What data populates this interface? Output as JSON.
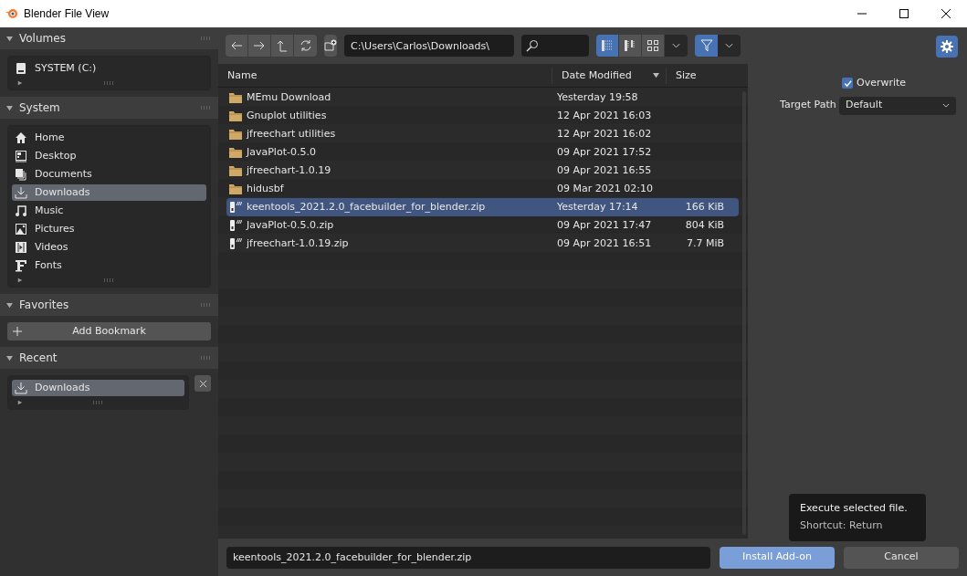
{
  "window": {
    "title": "Blender File View"
  },
  "sidebar": {
    "panels": [
      {
        "title": "Volumes",
        "expanded": true,
        "kind": "list",
        "items": [
          {
            "label": "SYSTEM (C:)",
            "kind": "drive",
            "selected": false
          }
        ]
      },
      {
        "title": "System",
        "expanded": true,
        "kind": "list",
        "items": [
          {
            "label": "Home",
            "kind": "home",
            "selected": false
          },
          {
            "label": "Desktop",
            "kind": "desktop",
            "selected": false
          },
          {
            "label": "Documents",
            "kind": "documents",
            "selected": false
          },
          {
            "label": "Downloads",
            "kind": "download",
            "selected": true
          },
          {
            "label": "Music",
            "kind": "music",
            "selected": false
          },
          {
            "label": "Pictures",
            "kind": "pictures",
            "selected": false
          },
          {
            "label": "Videos",
            "kind": "videos",
            "selected": false
          },
          {
            "label": "Fonts",
            "kind": "fonts",
            "selected": false
          }
        ]
      },
      {
        "title": "Favorites",
        "expanded": true,
        "kind": "button",
        "button": "Add Bookmark"
      },
      {
        "title": "Recent",
        "expanded": true,
        "kind": "list",
        "items": [
          {
            "label": "Downloads",
            "kind": "download",
            "selected": true
          }
        ]
      }
    ]
  },
  "toolbar": {
    "path": "C:\\Users\\Carlos\\Downloads\\",
    "display_modes": [
      {
        "kind": "vertical",
        "selected": true
      },
      {
        "kind": "horizontal",
        "selected": false
      },
      {
        "kind": "thumbnails",
        "selected": false
      }
    ],
    "filter_on": true
  },
  "table": {
    "columns": [
      "Name",
      "Date Modified",
      "Size"
    ],
    "rows": [
      {
        "kind": "folder",
        "name": "MEmu Download",
        "date": "Yesterday 19:58",
        "size": "",
        "selected": false
      },
      {
        "kind": "folder",
        "name": "Gnuplot utilities",
        "date": "12 Apr 2021 16:03",
        "size": "",
        "selected": false
      },
      {
        "kind": "folder",
        "name": "jfreechart utilities",
        "date": "12 Apr 2021 16:02",
        "size": "",
        "selected": false
      },
      {
        "kind": "folder",
        "name": "JavaPlot-0.5.0",
        "date": "09 Apr 2021 17:52",
        "size": "",
        "selected": false
      },
      {
        "kind": "folder",
        "name": "jfreechart-1.0.19",
        "date": "09 Apr 2021 16:55",
        "size": "",
        "selected": false
      },
      {
        "kind": "folder",
        "name": "hidusbf",
        "date": "09 Mar 2021 02:10",
        "size": "",
        "selected": false
      },
      {
        "kind": "zip",
        "name": "keentools_2021.2.0_facebuilder_for_blender.zip",
        "date": "Yesterday 17:14",
        "size": "166 KiB",
        "selected": true
      },
      {
        "kind": "zip",
        "name": "JavaPlot-0.5.0.zip",
        "date": "09 Apr 2021 17:47",
        "size": "804 KiB",
        "selected": false
      },
      {
        "kind": "zip",
        "name": "jfreechart-1.0.19.zip",
        "date": "09 Apr 2021 16:51",
        "size": "7.7 MiB",
        "selected": false
      }
    ]
  },
  "options": {
    "overwrite": {
      "label": "Overwrite",
      "checked": true
    },
    "target_path": {
      "label": "Target Path",
      "value": "Default"
    }
  },
  "footer": {
    "filename": "keentools_2021.2.0_facebuilder_for_blender.zip",
    "buttons": [
      "Install Add-on",
      "Cancel"
    ]
  },
  "tooltip": {
    "lines": [
      "Execute selected file.",
      "Shortcut: Return"
    ]
  }
}
